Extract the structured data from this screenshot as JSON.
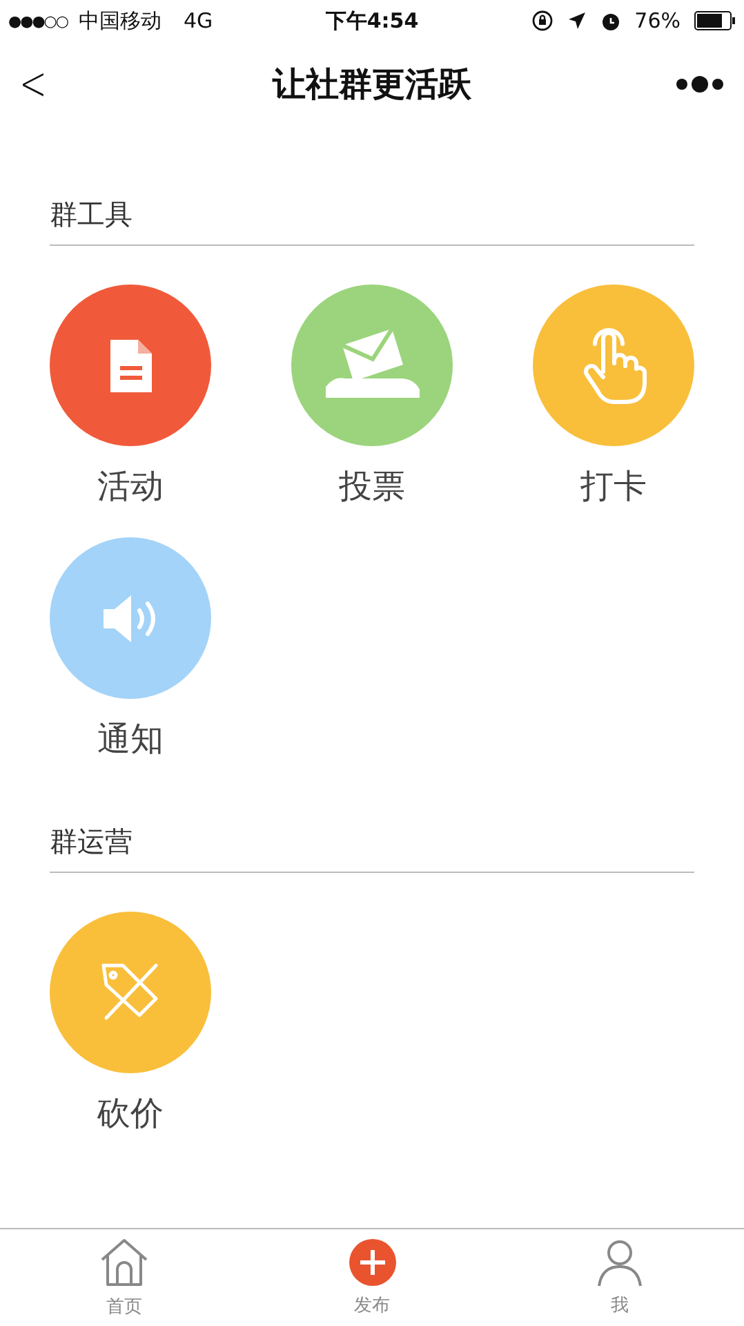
{
  "status_bar": {
    "signal": "●●●○○",
    "carrier": "中国移动",
    "network": "4G",
    "time": "下午4:54",
    "battery": "76%"
  },
  "nav": {
    "back": "<",
    "title": "让社群更活跃"
  },
  "sections": [
    {
      "title": "群工具",
      "items": [
        {
          "kind": "document",
          "label": "活动",
          "color": "#f05a3a"
        },
        {
          "kind": "envelope",
          "label": "投票",
          "color": "#9bd47c"
        },
        {
          "kind": "hand",
          "label": "打卡",
          "color": "#f9bf3b"
        },
        {
          "kind": "speaker",
          "label": "通知",
          "color": "#a3d3f8"
        }
      ]
    },
    {
      "title": "群运营",
      "items": [
        {
          "kind": "tag",
          "label": "砍价",
          "color": "#f9bf3b"
        }
      ]
    }
  ],
  "tab_bar": [
    {
      "kind": "home",
      "label": "首页"
    },
    {
      "kind": "publish",
      "label": "发布"
    },
    {
      "kind": "person",
      "label": "我"
    }
  ]
}
